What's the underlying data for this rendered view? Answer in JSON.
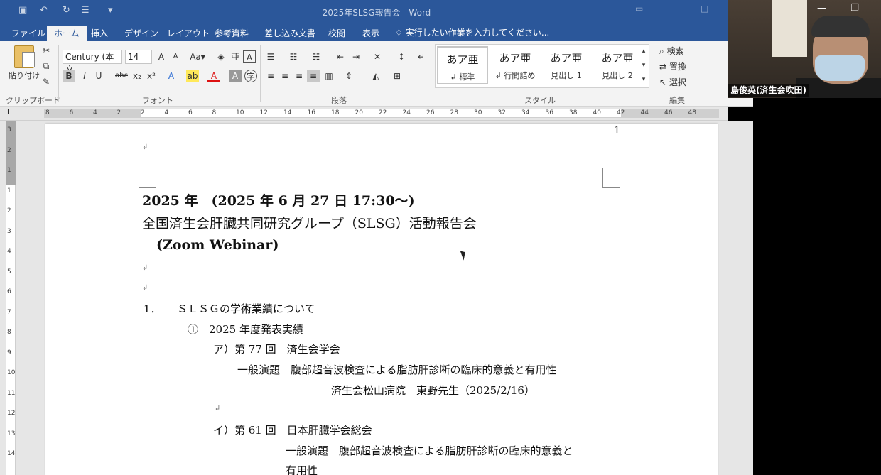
{
  "window": {
    "title": "2025年SLSG報告会 - Word",
    "quick_access": [
      "save-icon",
      "undo-icon",
      "redo-icon",
      "format-icon"
    ]
  },
  "menu": {
    "tabs": [
      "ファイル",
      "ホーム",
      "挿入",
      "デザイン",
      "レイアウト",
      "参考資料",
      "差し込み文書",
      "校閲",
      "表示"
    ],
    "active_tab": "ホーム",
    "tell_me": "実行したい作業を入力してください..."
  },
  "ribbon": {
    "clipboard": {
      "paste_label": "貼り付け",
      "group_label": "クリップボード"
    },
    "font": {
      "font_name": "Century (本文",
      "font_size": "14",
      "group_label": "フォント",
      "buttons": [
        "B",
        "I",
        "U",
        "abc",
        "x₂",
        "x²"
      ]
    },
    "paragraph": {
      "group_label": "段落"
    },
    "styles": {
      "group_label": "スタイル",
      "items": [
        {
          "preview": "あア亜",
          "name": "↲ 標準"
        },
        {
          "preview": "あア亜",
          "name": "↲ 行間詰め"
        },
        {
          "preview": "あア亜",
          "name": "見出し 1"
        },
        {
          "preview": "あア亜",
          "name": "見出し 2"
        }
      ]
    },
    "editing": {
      "group_label": "編集",
      "find": "検索",
      "replace": "置換",
      "select": "選択"
    }
  },
  "ruler": {
    "h_ticks": [
      "8",
      "6",
      "4",
      "2",
      "2",
      "4",
      "6",
      "8",
      "10",
      "12",
      "14",
      "16",
      "18",
      "20",
      "22",
      "24",
      "26",
      "28",
      "30",
      "32",
      "34",
      "36",
      "38",
      "40",
      "42",
      "44",
      "46",
      "48"
    ],
    "v_ticks": [
      "3",
      "2",
      "1",
      "1",
      "2",
      "3",
      "4",
      "5",
      "6",
      "7",
      "8",
      "9",
      "10",
      "11",
      "12",
      "13",
      "14"
    ]
  },
  "document": {
    "page_number": "1",
    "lines": [
      {
        "text": "2025 年　(2025 年 6 月 27 日 17:30～)"
      },
      {
        "text": "全国済生会肝臓共同研究グループ（SLSG）活動報告会"
      },
      {
        "text": "(Zoom Webinar)"
      },
      {
        "text": "1．　　ＳＬＳＧの学術業績について"
      },
      {
        "text": "①　2025 年度発表実績"
      },
      {
        "text": "ア）第 77 回　済生会学会"
      },
      {
        "text": "一般演題　腹部超音波検査による脂肪肝診断の臨床的意義と有用性"
      },
      {
        "text": "済生会松山病院　東野先生（2025/2/16）"
      },
      {
        "text": "イ）第 61 回　日本肝臓学会総会"
      },
      {
        "text": "一般演題　腹部超音波検査による脂肪肝診断の臨床的意義と"
      },
      {
        "text": "有用性"
      }
    ]
  },
  "video": {
    "participant_name": "島俊英(済生会吹田)",
    "colors": {
      "titlebar": "#2b579a",
      "ribbon": "#f3f3f3"
    }
  }
}
